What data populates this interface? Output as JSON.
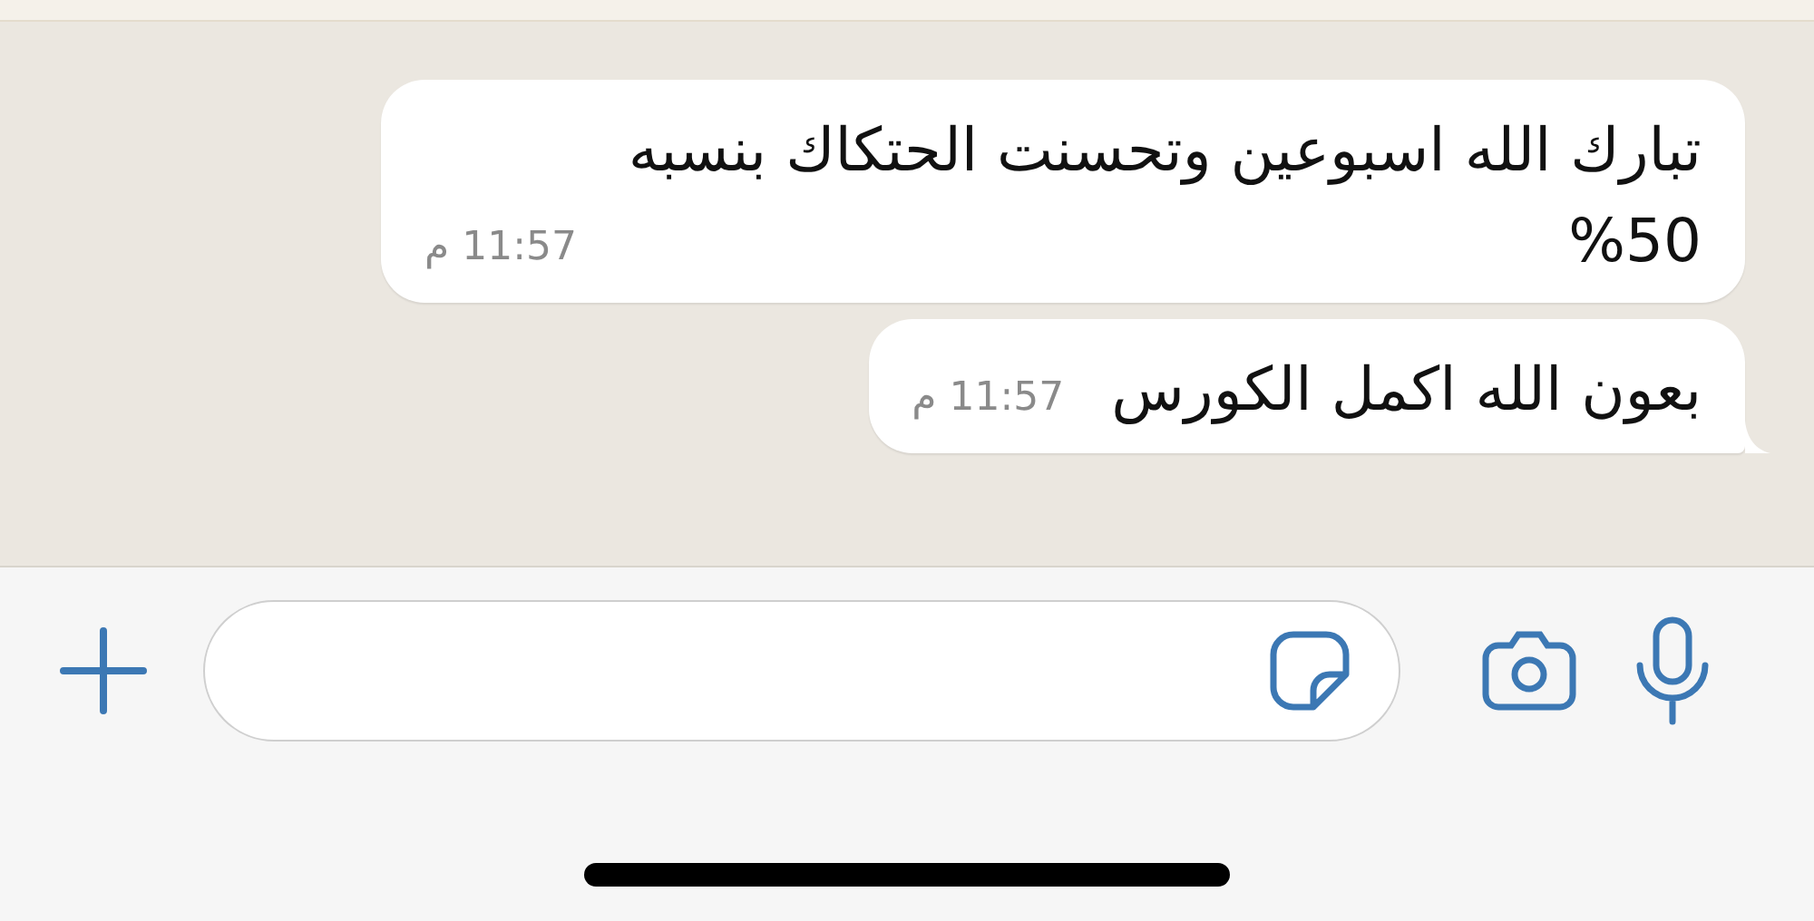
{
  "messages": [
    {
      "text": "تبارك الله اسبوعين وتحسنت الحتكاك بنسبه 50%",
      "time": "11:57 م",
      "tail": false
    },
    {
      "text": "بعون الله اكمل الكورس",
      "time": "11:57 م",
      "tail": true
    }
  ]
}
